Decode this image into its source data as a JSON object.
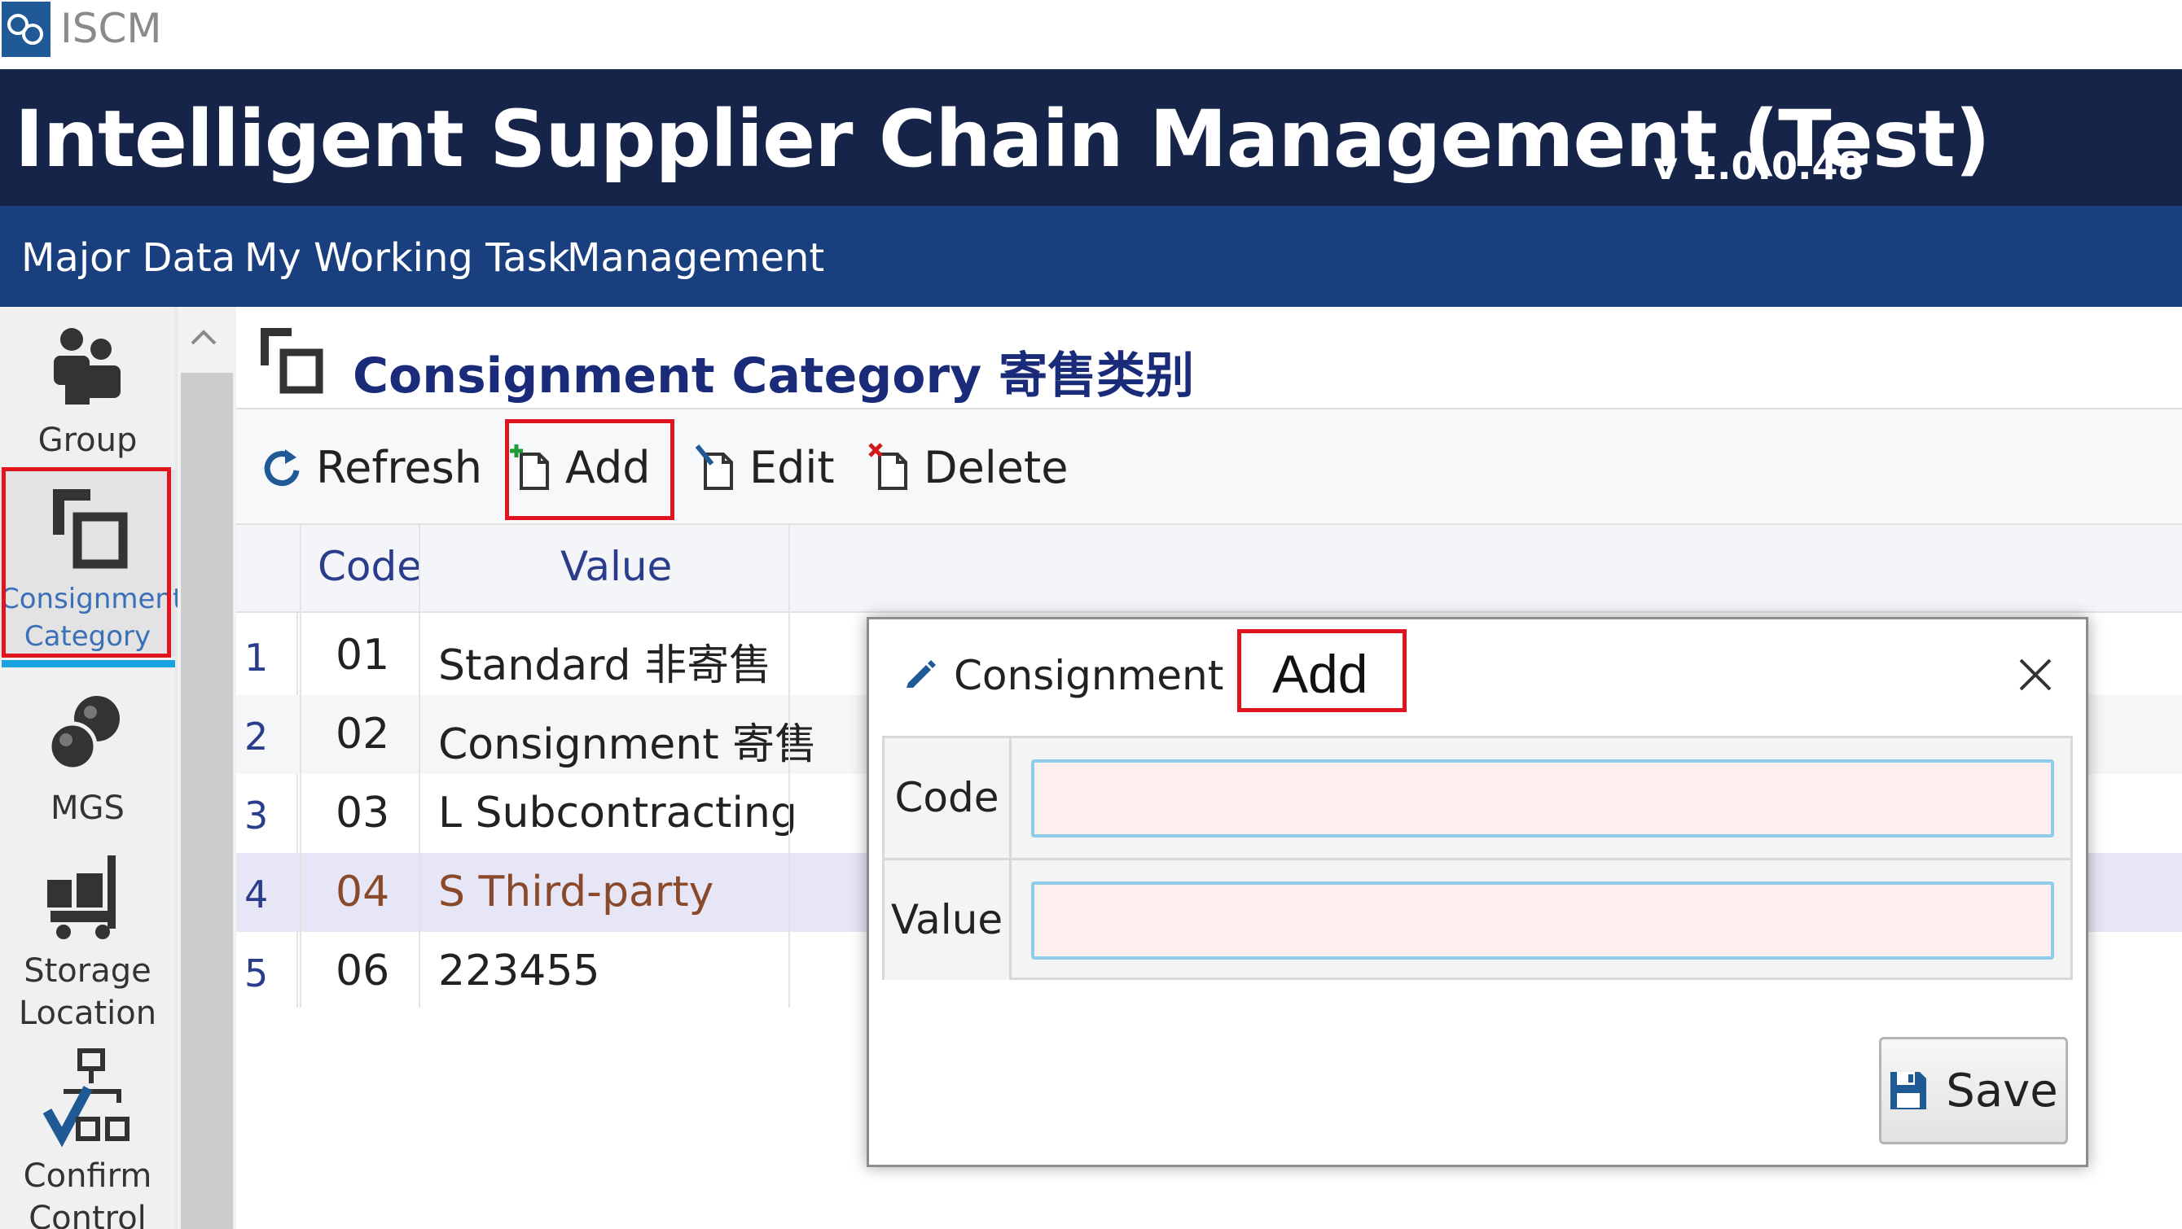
{
  "app": {
    "window_title": "ISCM",
    "header_title": "Intelligent Supplier Chain Management (Test)",
    "version": "v 1.0.0.48"
  },
  "menu": {
    "items": [
      "Major Data",
      "My Working Task",
      "Management"
    ]
  },
  "sidebar": {
    "items": [
      {
        "label": "Group",
        "icon": "group-icon"
      },
      {
        "label_line1": "Consignment",
        "label_line2": "Category",
        "icon": "consignment-category-icon",
        "active": true
      },
      {
        "label": "MGS",
        "icon": "mgs-icon"
      },
      {
        "label_line1": "Storage",
        "label_line2": "Location",
        "icon": "storage-location-icon"
      },
      {
        "label_line1": "Confirm",
        "label_line2": "Control",
        "icon": "confirm-control-icon"
      }
    ]
  },
  "page": {
    "title": "Consignment Category 寄售类别"
  },
  "toolbar": {
    "refresh": "Refresh",
    "add": "Add",
    "edit": "Edit",
    "delete": "Delete"
  },
  "grid": {
    "columns": [
      "Code",
      "Value"
    ],
    "rows": [
      {
        "num": "1",
        "code": "01",
        "value": "Standard 非寄售"
      },
      {
        "num": "2",
        "code": "02",
        "value": "Consignment 寄售"
      },
      {
        "num": "3",
        "code": "03",
        "value": "L Subcontracting"
      },
      {
        "num": "4",
        "code": "04",
        "value": "S Third-party",
        "selected": true
      },
      {
        "num": "5",
        "code": "06",
        "value": "223455"
      }
    ]
  },
  "dialog": {
    "title": "Consignment",
    "mode": "Add",
    "fields": [
      {
        "label": "Code",
        "value": "",
        "placeholder": ""
      },
      {
        "label": "Value",
        "value": "",
        "placeholder": ""
      }
    ],
    "save": "Save"
  },
  "colors": {
    "header_bg": "#16244a",
    "menubar_bg": "#1a3f7e",
    "highlight_red": "#e0141e",
    "active_tab_underline": "#1aa3e0",
    "input_bg": "#fff0f0"
  }
}
